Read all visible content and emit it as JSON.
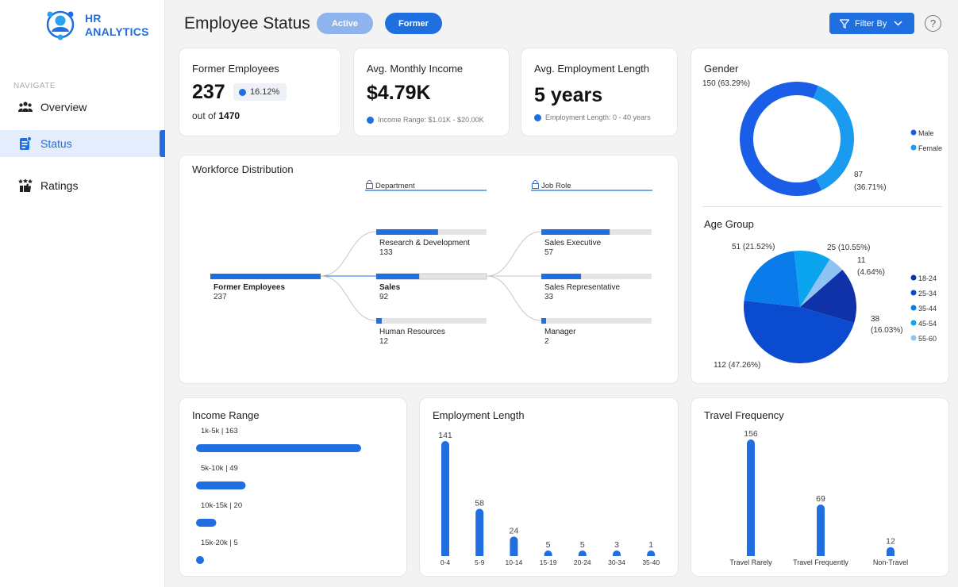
{
  "app": {
    "title_line1": "HR",
    "title_line2": "ANALYTICS"
  },
  "nav": {
    "caption": "NAVIGATE",
    "items": [
      {
        "label": "Overview",
        "icon": "people-icon"
      },
      {
        "label": "Status",
        "icon": "status-doc-icon",
        "active": true
      },
      {
        "label": "Ratings",
        "icon": "ratings-icon"
      }
    ]
  },
  "header": {
    "title": "Employee Status",
    "toggle_active": "Active",
    "toggle_former": "Former",
    "filter_label": "Filter By",
    "help": "?"
  },
  "kpis": {
    "former": {
      "title": "Former Employees",
      "value": "237",
      "percent": "16.12%",
      "out_of_prefix": "out of",
      "out_of_value": "1470"
    },
    "income": {
      "title": "Avg. Monthly Income",
      "value": "$4.79K",
      "note": "Income Range: $1.01K - $20.00K"
    },
    "length": {
      "title": "Avg. Employment Length",
      "value": "5 years",
      "note": "Employment Length: 0 - 40 years"
    }
  },
  "colors": {
    "accent": "#1f6fe0",
    "track": "#e4e4e4",
    "male": "#1a5ee8",
    "female": "#1a9bef"
  },
  "workforce": {
    "title": "Workforce Distribution",
    "level1_header": "Department",
    "level2_header": "Job Role",
    "root": {
      "label": "Former Employees",
      "value": "237"
    },
    "departments": [
      {
        "label": "Research & Development",
        "value": "133",
        "fraction": 0.56
      },
      {
        "label": "Sales",
        "value": "92",
        "fraction": 0.39
      },
      {
        "label": "Human Resources",
        "value": "12",
        "fraction": 0.05
      }
    ],
    "roles": [
      {
        "label": "Sales Executive",
        "value": "57",
        "fraction": 0.62
      },
      {
        "label": "Sales Representative",
        "value": "33",
        "fraction": 0.36
      },
      {
        "label": "Manager",
        "value": "2",
        "fraction": 0.02
      }
    ]
  },
  "chart_data": [
    {
      "id": "gender",
      "type": "pie",
      "title": "Gender",
      "categories": [
        "Male",
        "Female"
      ],
      "values": [
        150,
        87
      ],
      "labels": [
        "150 (63.29%)",
        "87\n(36.71%)"
      ],
      "colors": [
        "#1a5ee8",
        "#1a9bef"
      ],
      "legend": "right"
    },
    {
      "id": "age",
      "type": "pie",
      "title": "Age Group",
      "categories": [
        "18-24",
        "25-34",
        "35-44",
        "45-54",
        "55-60"
      ],
      "values": [
        38,
        112,
        51,
        25,
        11
      ],
      "labels": [
        "38\n(16.03%)",
        "112 (47.26%)",
        "51 (21.52%)",
        "25 (10.55%)",
        "11\n(4.64%)"
      ],
      "colors": [
        "#0f32a8",
        "#0b4bd0",
        "#0a7bea",
        "#0aa5ee",
        "#8fc3f3"
      ],
      "legend": "right"
    },
    {
      "id": "income",
      "type": "bar",
      "title": "Income Range",
      "orientation": "horizontal",
      "categories": [
        "1k-5k",
        "5k-10k",
        "10k-15k",
        "15k-20k"
      ],
      "values": [
        163,
        49,
        20,
        5
      ],
      "labels": [
        "1k-5k | 163",
        "5k-10k | 49",
        "10k-15k | 20",
        "15k-20k | 5"
      ]
    },
    {
      "id": "employment",
      "type": "bar",
      "title": "Employment Length",
      "categories": [
        "0-4",
        "5-9",
        "10-14",
        "15-19",
        "20-24",
        "30-34",
        "35-40"
      ],
      "values": [
        141,
        58,
        24,
        5,
        5,
        3,
        1
      ]
    },
    {
      "id": "travel",
      "type": "bar",
      "title": "Travel Frequency",
      "categories": [
        "Travel Rarely",
        "Travel Frequently",
        "Non-Travel"
      ],
      "values": [
        156,
        69,
        12
      ]
    }
  ]
}
